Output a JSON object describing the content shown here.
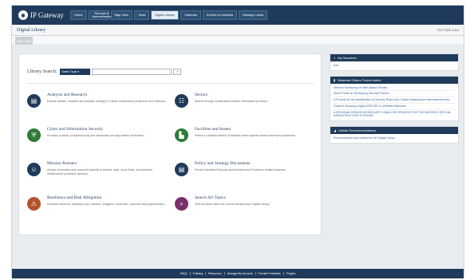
{
  "brand": {
    "name": "IP Gateway"
  },
  "nav": [
    {
      "label": "Home"
    },
    {
      "label": "Surveys & Assessments"
    },
    {
      "label": "Map View"
    },
    {
      "label": "Tools"
    },
    {
      "label": "Digital Library"
    },
    {
      "label": "Calendar"
    },
    {
      "label": "Events & Incidents"
    },
    {
      "label": "Manage Users"
    }
  ],
  "page": {
    "title": "Digital Library",
    "text_size": "TEXT SIZE: A A A"
  },
  "main_tab": {
    "label": "Main Page"
  },
  "search": {
    "label": "Library Search:",
    "topic_button": "Select Topic ▾",
    "placeholder": ""
  },
  "topics": [
    {
      "title": "Analysis and Research",
      "desc": "Explore articles, research and analysis relating to Critical Infrastructure protection and resilience.",
      "icon": "document-icon",
      "color": "#1f3a5a"
    },
    {
      "title": "Sectors",
      "desc": "Search through infrastructure-related information by Sector.",
      "icon": "sectors-icon",
      "color": "#1f3a5a"
    },
    {
      "title": "Cyber and Information Security",
      "desc": "Provides a variety of cybersecurity and information security related information.",
      "icon": "shield-icon",
      "color": "#2f7a3a"
    },
    {
      "title": "Facilities and Assets",
      "desc": "Perform a detailed search of facilities where specific assets have been performed.",
      "icon": "building-icon",
      "color": "#2f7a3a"
    },
    {
      "title": "Mission Partners",
      "desc": "Access information and resources specific to federal, state, local, tribal, and territorial infrastructure protection partners.",
      "icon": "people-icon",
      "color": "#1f3a5a"
    },
    {
      "title": "Policy and Strategy Documents",
      "desc": "Peruse Homeland Security and Infrastructure Protection related materials.",
      "icon": "document-icon",
      "color": "#1f3a5a"
    },
    {
      "title": "Resilience and Risk Mitigation",
      "desc": "Examine resources relating to risk, hazards, mitigation, protection, response and preparedness.",
      "icon": "warning-icon",
      "color": "#b4532a"
    },
    {
      "title": "Search All Topics",
      "desc": "View all topics within the Critical Infrastructure Digital Library.",
      "icon": "search-icon",
      "color": "#7a2f6a"
    }
  ],
  "widgets": {
    "my_searches": {
      "title": "My Searches",
      "items": [
        "Add"
      ]
    },
    "materials": {
      "title": "Materials Others Found Useful",
      "items": [
        "Network Monitoring for Web-Based Threats",
        "Short Primer on Developing Security Policies",
        "A Process for the Identification of Security Risks from Critical Infrastructure Interdependencies",
        "Guide to Securing Legacy IEEE 802.11 Wireless Networks",
        "A REGIONAL RESILIENCE/SECURITY ANALYSIS PROCESS FOR THE NATION'S CRITICAL INFRASTRUCTURE SYSTEMS"
      ]
    },
    "artifact": {
      "title": "Artifact Recommendations",
      "items": [
        "Recommended new content for the Digital Library"
      ]
    }
  },
  "footer": [
    "FAQs",
    "Training",
    "Resources",
    "Manage My Account",
    "Provide Feedback",
    "Plugins"
  ]
}
